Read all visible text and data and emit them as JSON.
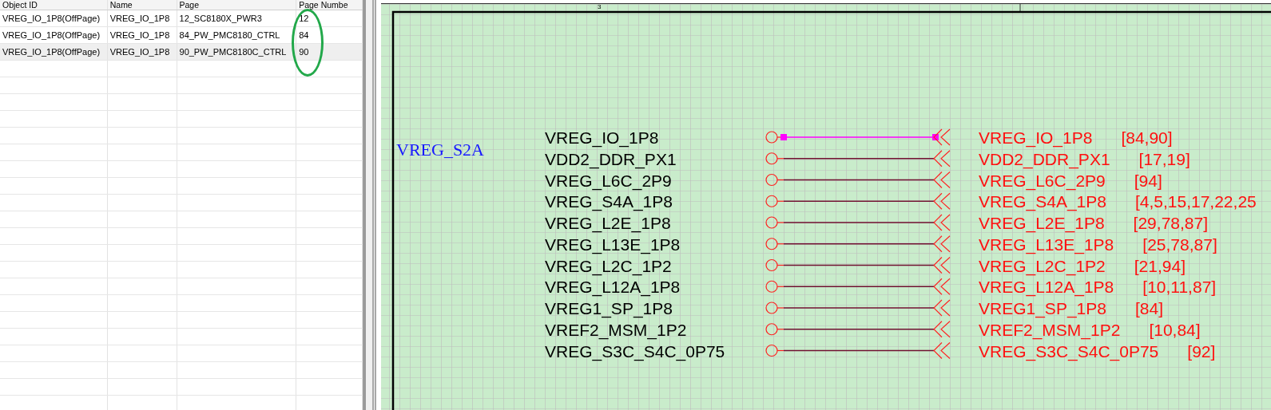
{
  "table": {
    "columns": [
      "Object ID",
      "Name",
      "Page",
      "Page Numbe"
    ],
    "rows": [
      {
        "cells": [
          "VREG_IO_1P8(OffPage)",
          "VREG_IO_1P8",
          "12_SC8180X_PWR3",
          "12"
        ],
        "selected": false
      },
      {
        "cells": [
          "VREG_IO_1P8(OffPage)",
          "VREG_IO_1P8",
          "84_PW_PMC8180_CTRL",
          "84"
        ],
        "selected": false
      },
      {
        "cells": [
          "VREG_IO_1P8(OffPage)",
          "VREG_IO_1P8",
          "90_PW_PMC8180C_CTRL",
          "90"
        ],
        "selected": true
      }
    ]
  },
  "schematic": {
    "zone_marker": "3",
    "bus_label": "VREG_S2A",
    "nets": [
      {
        "name": "VREG_IO_1P8",
        "offpage_label": "VREG_IO_1P8",
        "pages": "[84,90]",
        "selected": true
      },
      {
        "name": "VDD2_DDR_PX1",
        "offpage_label": "VDD2_DDR_PX1",
        "pages": "[17,19]",
        "selected": false
      },
      {
        "name": "VREG_L6C_2P9",
        "offpage_label": "VREG_L6C_2P9",
        "pages": "[94]",
        "selected": false
      },
      {
        "name": "VREG_S4A_1P8",
        "offpage_label": "VREG_S4A_1P8",
        "pages": "[4,5,15,17,22,25",
        "selected": false
      },
      {
        "name": "VREG_L2E_1P8",
        "offpage_label": "VREG_L2E_1P8",
        "pages": "[29,78,87]",
        "selected": false
      },
      {
        "name": "VREG_L13E_1P8",
        "offpage_label": "VREG_L13E_1P8",
        "pages": "[25,78,87]",
        "selected": false
      },
      {
        "name": "VREG_L2C_1P2",
        "offpage_label": "VREG_L2C_1P2",
        "pages": "[21,94]",
        "selected": false
      },
      {
        "name": "VREG_L12A_1P8",
        "offpage_label": "VREG_L12A_1P8",
        "pages": "[10,11,87]",
        "selected": false
      },
      {
        "name": "VREG1_SP_1P8",
        "offpage_label": "VREG1_SP_1P8",
        "pages": "[84]",
        "selected": false
      },
      {
        "name": "VREF2_MSM_1P2",
        "offpage_label": "VREF2_MSM_1P2",
        "pages": "[10,84]",
        "selected": false
      },
      {
        "name": "VREG_S3C_S4C_0P75",
        "offpage_label": "VREG_S3C_S4C_0P75",
        "pages": "[92]",
        "selected": false
      }
    ]
  }
}
